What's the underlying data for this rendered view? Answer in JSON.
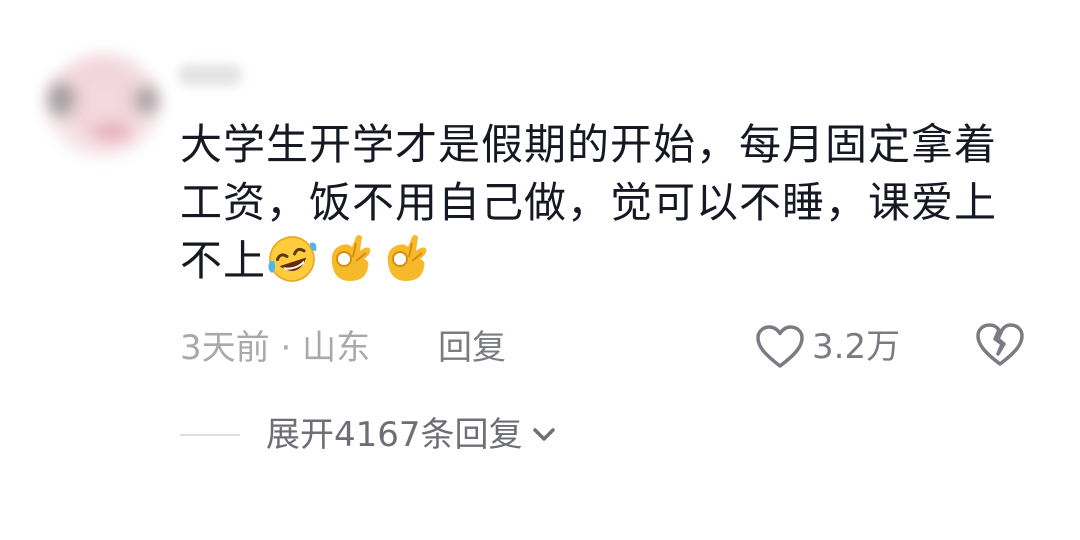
{
  "comment": {
    "text": "大学生开学才是假期的开始，每月固定拿着工资，饭不用自己做，觉可以不睡，课爱上不上",
    "emojis": [
      "rofl-emoji",
      "ok-hand-emoji",
      "ok-hand-emoji"
    ]
  },
  "meta": {
    "time": "3天前",
    "separator": " · ",
    "location": "山东",
    "reply_label": "回复"
  },
  "actions": {
    "like_count": "3.2万",
    "like_icon": "heart-outline-icon",
    "dislike_icon": "broken-heart-icon"
  },
  "replies": {
    "expand_label": "展开4167条回复",
    "chevron_icon": "chevron-down-icon"
  },
  "colors": {
    "text_primary": "#161823",
    "text_secondary": "#a9a9ad",
    "text_action": "#7b7c83"
  }
}
